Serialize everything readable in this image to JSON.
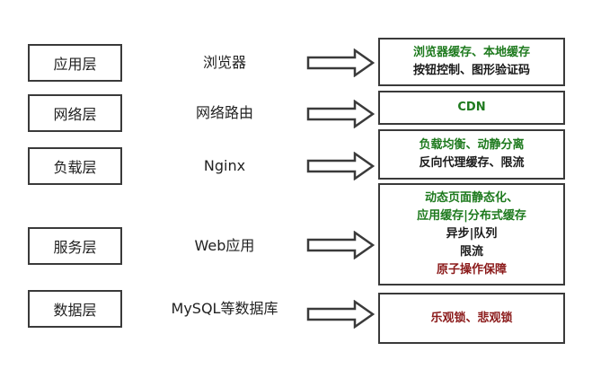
{
  "colors": {
    "border": "#3a3a3a",
    "green": "#1e7a1e",
    "black": "#1a1a1a",
    "red": "#8b1a1a"
  },
  "rows": [
    {
      "layer": "应用层",
      "tech": "浏览器",
      "solutions": [
        {
          "text": "浏览器缓存、本地缓存",
          "color": "green"
        },
        {
          "text": "按钮控制、图形验证码",
          "color": "black"
        }
      ]
    },
    {
      "layer": "网络层",
      "tech": "网络路由",
      "solutions": [
        {
          "text": "CDN",
          "color": "green"
        }
      ]
    },
    {
      "layer": "负载层",
      "tech": "Nginx",
      "solutions": [
        {
          "text": "负载均衡、动静分离",
          "color": "green"
        },
        {
          "text": "反向代理缓存、限流",
          "color": "black"
        }
      ]
    },
    {
      "layer": "服务层",
      "tech": "Web应用",
      "solutions": [
        {
          "text": "动态页面静态化、",
          "color": "green"
        },
        {
          "text": "应用缓存|分布式缓存",
          "color": "green"
        },
        {
          "text": "异步|队列",
          "color": "black"
        },
        {
          "text": "限流",
          "color": "black"
        },
        {
          "text": "原子操作保障",
          "color": "red"
        }
      ]
    },
    {
      "layer": "数据层",
      "tech": "MySQL等数据库",
      "solutions": [
        {
          "text": "乐观锁、悲观锁",
          "color": "red"
        }
      ]
    }
  ]
}
